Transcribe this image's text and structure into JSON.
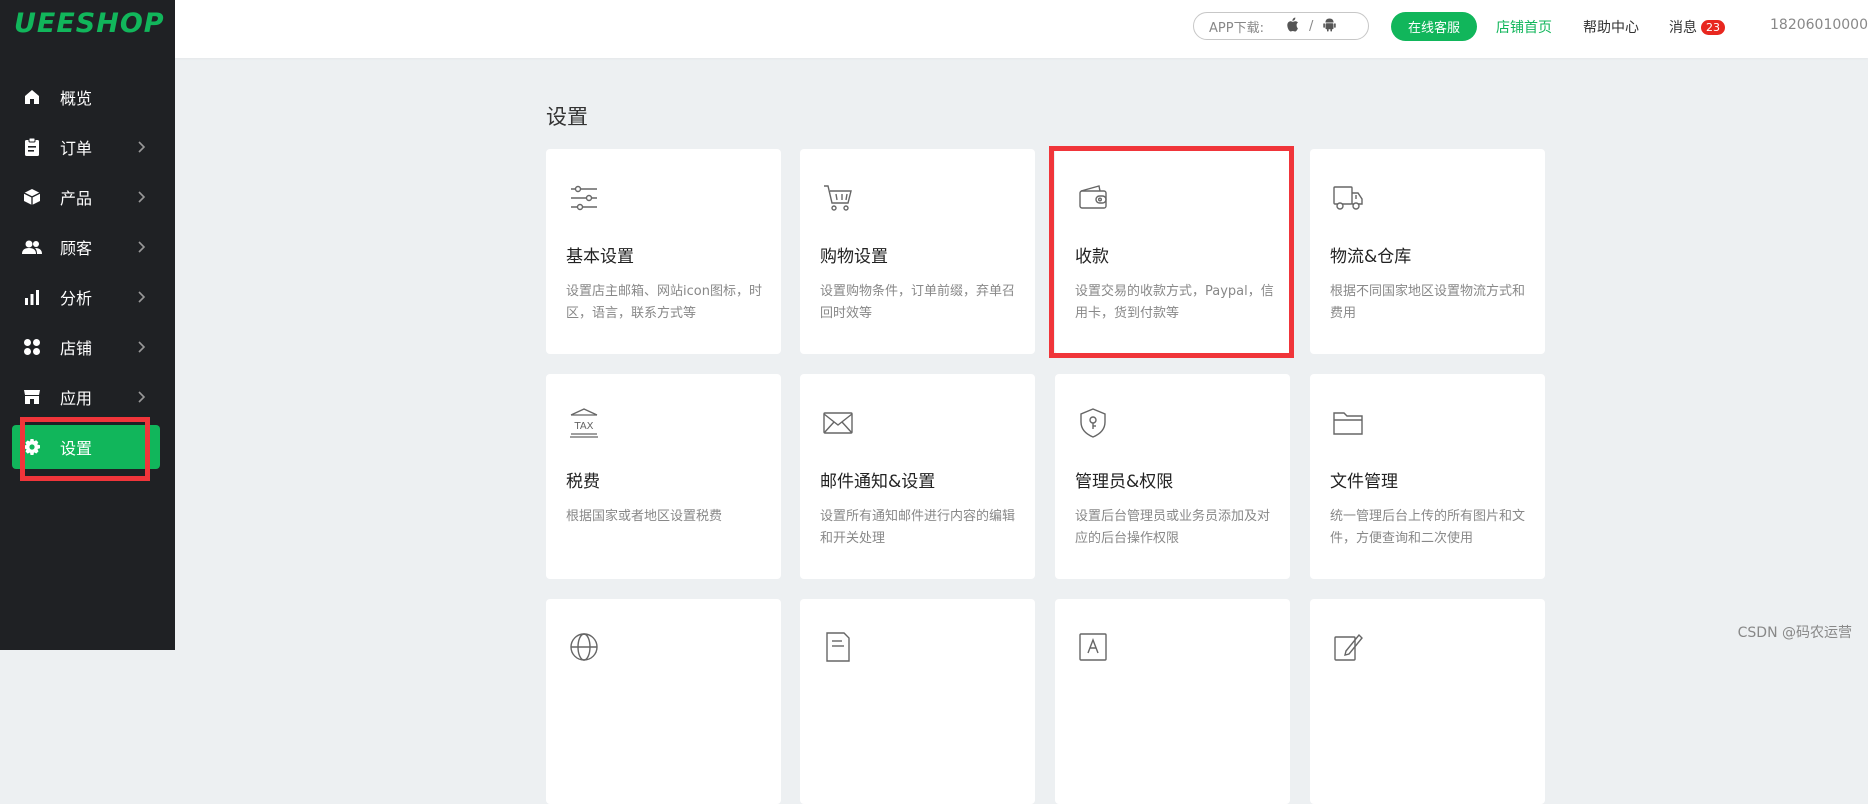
{
  "brand": {
    "logo": "UEESHOP",
    "accent": "#11b65b"
  },
  "sidebar": {
    "items": [
      {
        "label": "概览",
        "icon": "home-icon",
        "has_children": false
      },
      {
        "label": "订单",
        "icon": "clipboard-icon",
        "has_children": true
      },
      {
        "label": "产品",
        "icon": "box-icon",
        "has_children": true
      },
      {
        "label": "顾客",
        "icon": "users-icon",
        "has_children": true
      },
      {
        "label": "分析",
        "icon": "bar-chart-icon",
        "has_children": true
      },
      {
        "label": "店铺",
        "icon": "store-grid-icon",
        "has_children": true
      },
      {
        "label": "应用",
        "icon": "app-store-icon",
        "has_children": true
      },
      {
        "label": "设置",
        "icon": "gear-icon",
        "has_children": false,
        "active": true
      }
    ]
  },
  "topbar": {
    "app_download": "APP下载:",
    "app_sep": "/",
    "service_button": "在线客服",
    "store_home": "店铺首页",
    "help_center": "帮助中心",
    "messages": "消息",
    "message_count": "23",
    "user": "18206010000"
  },
  "main": {
    "title": "设置",
    "cards": [
      {
        "title": "基本设置",
        "desc": "设置店主邮箱、网站icon图标，时区，语言，联系方式等",
        "icon": "sliders-icon"
      },
      {
        "title": "购物设置",
        "desc": "设置购物条件，订单前缀，弃单召回时效等",
        "icon": "cart-icon"
      },
      {
        "title": "收款",
        "desc": "设置交易的收款方式，Paypal，信用卡，货到付款等",
        "icon": "wallet-icon"
      },
      {
        "title": "物流&仓库",
        "desc": "根据不同国家地区设置物流方式和费用",
        "icon": "truck-icon"
      },
      {
        "title": "税费",
        "desc": "根据国家或者地区设置税费",
        "icon": "tax-icon"
      },
      {
        "title": "邮件通知&设置",
        "desc": "设置所有通知邮件进行内容的编辑和开关处理",
        "icon": "mail-icon"
      },
      {
        "title": "管理员&权限",
        "desc": "设置后台管理员或业务员添加及对应的后台操作权限",
        "icon": "shield-key-icon"
      },
      {
        "title": "文件管理",
        "desc": "统一管理后台上传的所有图片和文件，方便查询和二次使用",
        "icon": "folder-icon"
      },
      {
        "title": "",
        "desc": "",
        "icon": "globe-icon"
      },
      {
        "title": "",
        "desc": "",
        "icon": "document-icon"
      },
      {
        "title": "",
        "desc": "",
        "icon": "text-frame-icon"
      },
      {
        "title": "",
        "desc": "",
        "icon": "edit-icon"
      }
    ]
  },
  "watermark": "CSDN @码农运营"
}
